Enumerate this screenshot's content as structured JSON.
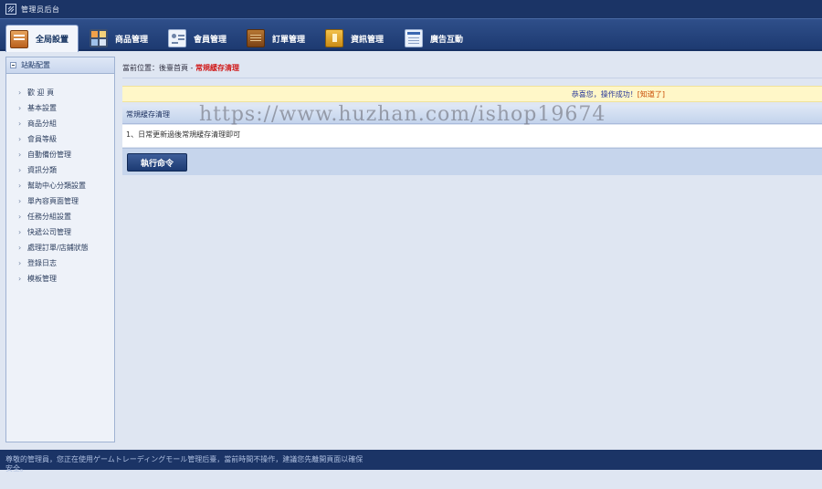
{
  "app": {
    "title": "管理员后台"
  },
  "tabs": [
    {
      "label": "全局設置",
      "icon": "settings-icon",
      "active": true
    },
    {
      "label": "商品管理",
      "icon": "grid-icon",
      "active": false
    },
    {
      "label": "會員管理",
      "icon": "user-card-icon",
      "active": false
    },
    {
      "label": "訂單管理",
      "icon": "order-book-icon",
      "active": false
    },
    {
      "label": "資訊管理",
      "icon": "news-icon",
      "active": false
    },
    {
      "label": "廣告互動",
      "icon": "ad-icon",
      "active": false
    }
  ],
  "sidebar": {
    "title": "站點配置",
    "items": [
      {
        "label": "歡 迎 頁"
      },
      {
        "label": "基本設置"
      },
      {
        "label": "商品分組"
      },
      {
        "label": "會員等級"
      },
      {
        "label": "自動備份管理"
      },
      {
        "label": "資訊分類"
      },
      {
        "label": "幫助中心分類設置"
      },
      {
        "label": "單內容頁面管理"
      },
      {
        "label": "任務分組設置"
      },
      {
        "label": "快遞公司管理"
      },
      {
        "label": "處理訂單/店鋪狀態"
      },
      {
        "label": "登錄日志"
      },
      {
        "label": "模板管理"
      }
    ]
  },
  "breadcrumb": {
    "prefix": "當前位置：後臺首頁 - ",
    "current": "常規緩存清理"
  },
  "notice": {
    "message": "恭喜您，操作成功！",
    "close": "[知道了]"
  },
  "panel": {
    "title": "常規緩存清理",
    "instruction": "1、日常更新過後常規緩存清理即可",
    "button": "執行命令"
  },
  "watermark": "https://www.huzhan.com/ishop19674",
  "footer": {
    "text": "尊敬的管理員，您正在使用ゲームトレーディングモール管理后臺，當前時間不操作，建議您先離開頁面以確保安全。"
  },
  "colors": {
    "header_bg": "#1b3466",
    "accent_red": "#d01919",
    "notice_bg": "#fff7c8"
  }
}
